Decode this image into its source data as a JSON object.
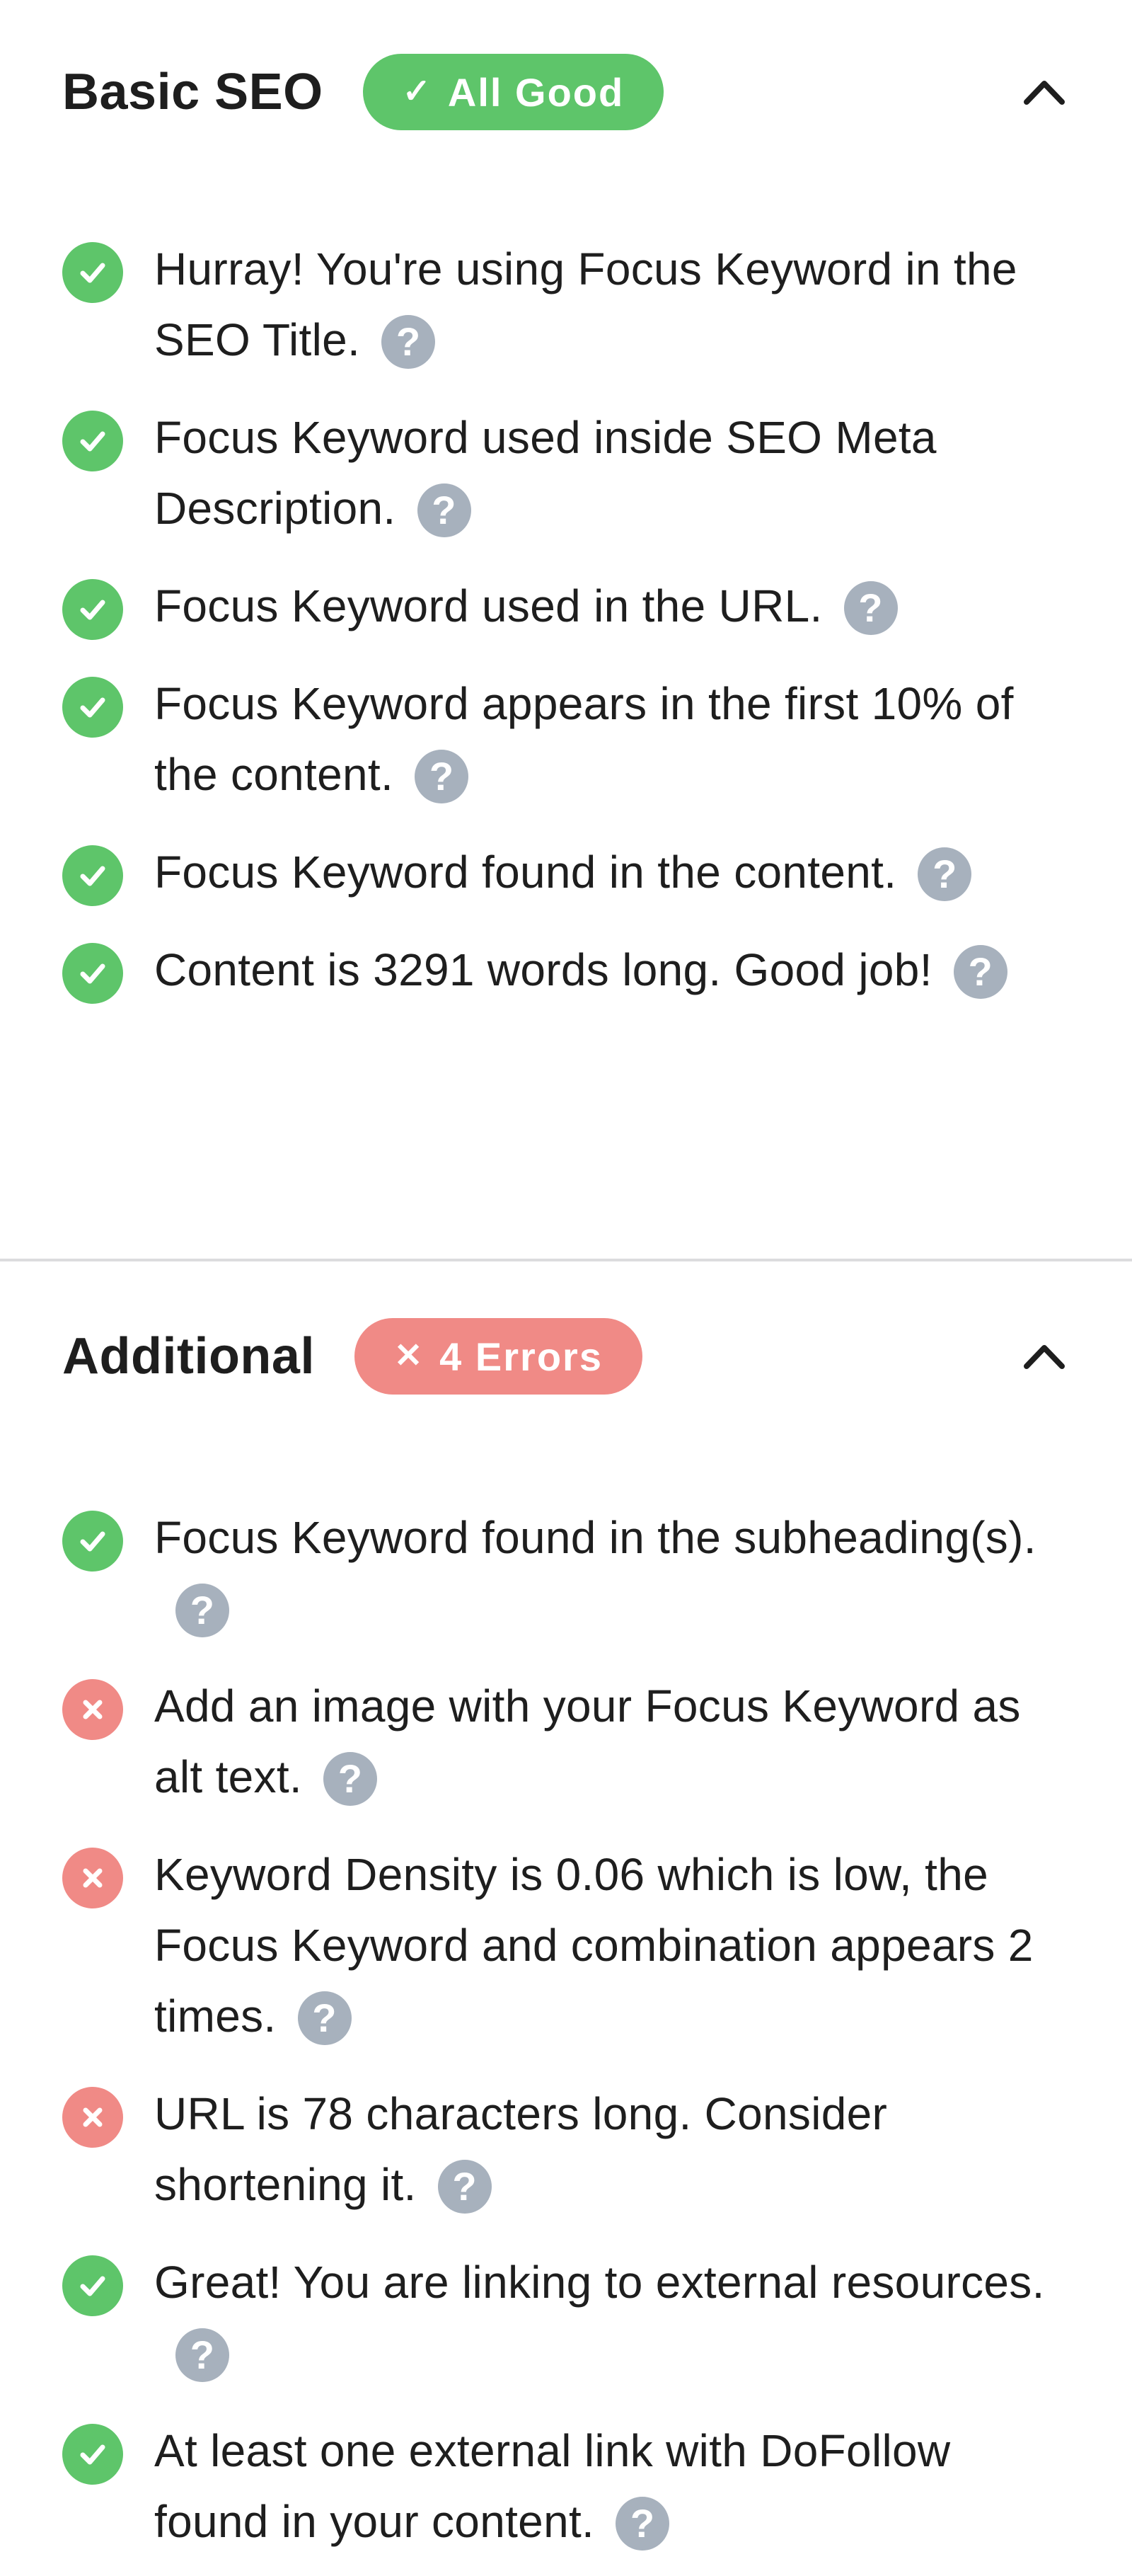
{
  "sections": {
    "basic": {
      "title": "Basic SEO",
      "badge": {
        "label": "All Good",
        "icon": "check-icon",
        "status": "good"
      },
      "collapse_icon": "chevron-up-icon",
      "items": [
        {
          "status": "ok",
          "text": "Hurray! You're using Focus Keyword in the SEO Title."
        },
        {
          "status": "ok",
          "text": "Focus Keyword used inside SEO Meta Description."
        },
        {
          "status": "ok",
          "text": "Focus Keyword used in the URL."
        },
        {
          "status": "ok",
          "text": "Focus Keyword appears in the first 10% of the content."
        },
        {
          "status": "ok",
          "text": "Focus Keyword found in the content."
        },
        {
          "status": "ok",
          "text": "Content is 3291 words long. Good job!"
        }
      ]
    },
    "additional": {
      "title": "Additional",
      "badge": {
        "label": "4 Errors",
        "icon": "x-icon",
        "status": "bad"
      },
      "collapse_icon": "chevron-up-icon",
      "items": [
        {
          "status": "ok",
          "text": "Focus Keyword found in the subheading(s)."
        },
        {
          "status": "err",
          "text": "Add an image with your Focus Keyword as alt text."
        },
        {
          "status": "err",
          "text": "Keyword Density is 0.06 which is low, the Focus Keyword and combination appears 2 times."
        },
        {
          "status": "err",
          "text": "URL is 78 characters long. Consider shortening it."
        },
        {
          "status": "ok",
          "text": "Great! You are linking to external resources."
        },
        {
          "status": "ok",
          "text": "At least one external link with DoFollow found in your content."
        }
      ]
    }
  },
  "help_glyph": "?",
  "colors": {
    "good": "#5ec56a",
    "bad": "#f08a86",
    "help": "#a7b1bd",
    "divider": "#dcdcde",
    "text": "#1e1e1e"
  }
}
